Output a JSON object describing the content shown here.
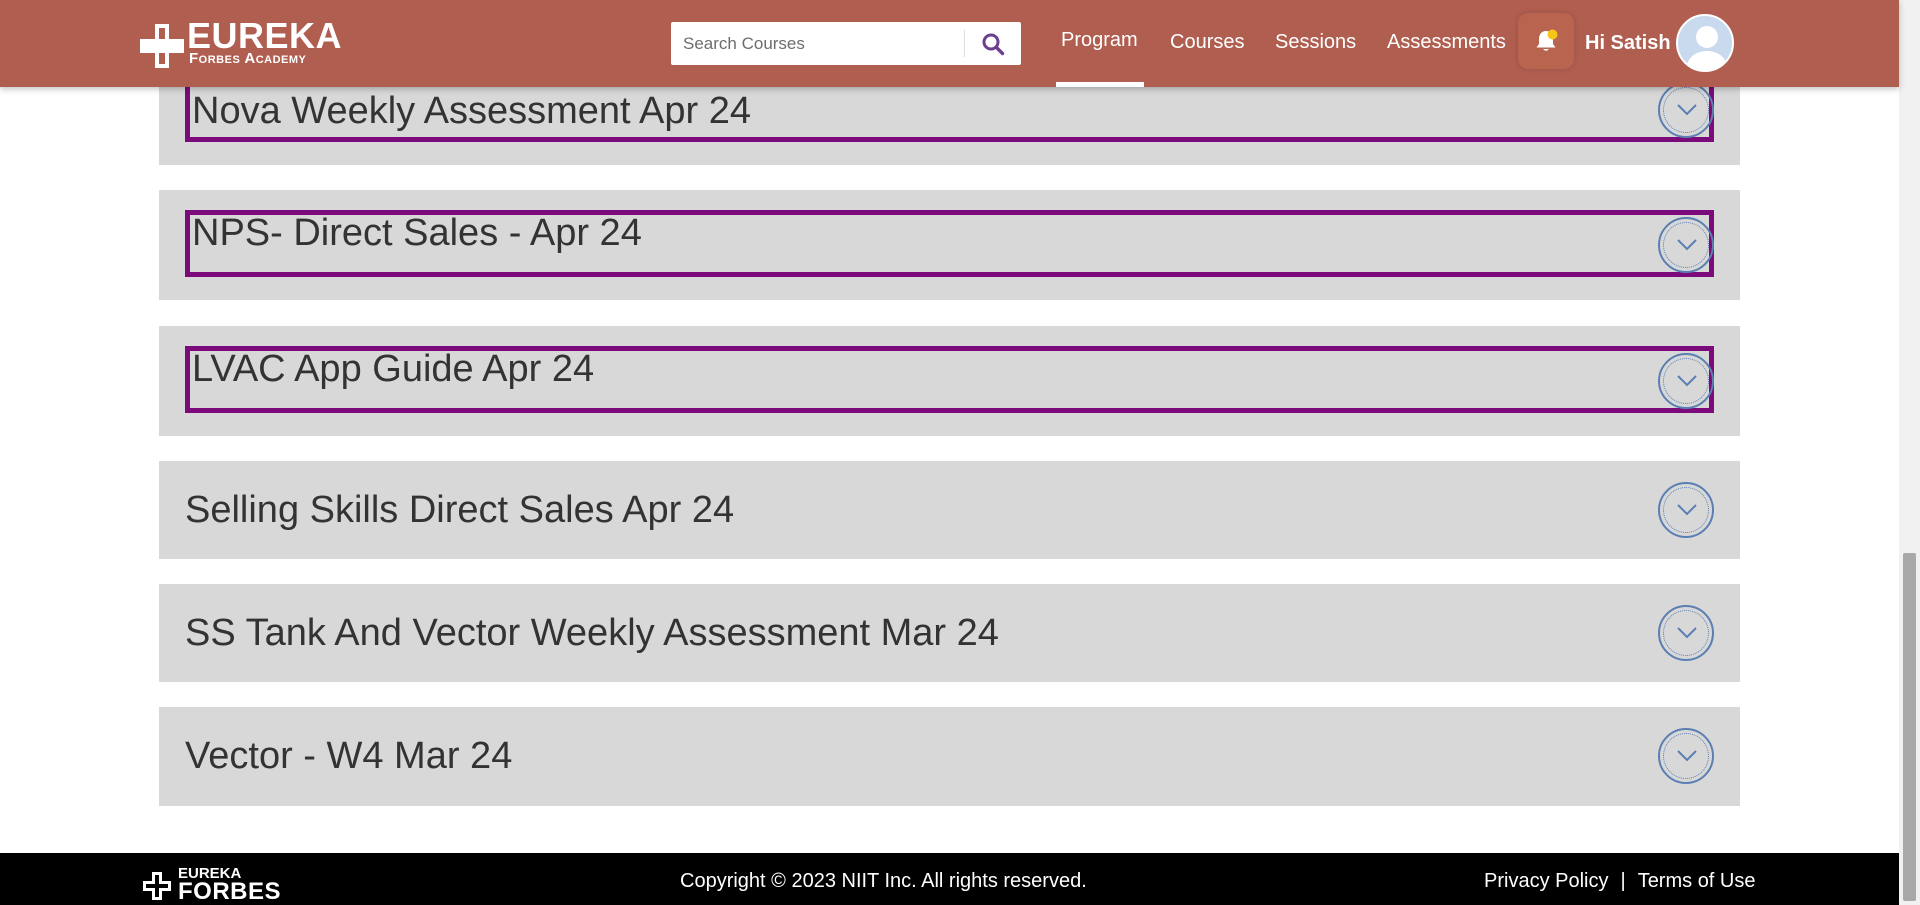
{
  "header": {
    "logo_line1": "EUREKA",
    "logo_line2": "Forbes Academy",
    "search": {
      "placeholder": "Search Courses",
      "value": ""
    },
    "nav": {
      "program": "Program",
      "courses": "Courses",
      "sessions": "Sessions",
      "assessments": "Assessments",
      "active": "Program"
    },
    "greeting": "Hi Satish",
    "colors": {
      "background": "#b05e50",
      "bell_dot": "#f5c518"
    }
  },
  "accordion": {
    "items": [
      {
        "title": "Nova Weekly Assessment Apr 24",
        "highlighted": true
      },
      {
        "title": "NPS- Direct Sales - Apr 24",
        "highlighted": true
      },
      {
        "title": "LVAC App Guide Apr 24",
        "highlighted": true
      },
      {
        "title": "Selling Skills Direct Sales Apr 24",
        "highlighted": false
      },
      {
        "title": "SS Tank And Vector Weekly Assessment Mar 24",
        "highlighted": false
      },
      {
        "title": "Vector - W4 Mar 24",
        "highlighted": false
      }
    ],
    "colors": {
      "panel": "#d8d8d8",
      "highlight_border": "#7b0a7b",
      "chevron": "#5b7fb2"
    }
  },
  "footer": {
    "logo_line1": "EUREKA",
    "logo_line2": "FORBES",
    "copyright": "Copyright © 2023 NIIT Inc. All rights reserved.",
    "privacy": "Privacy Policy",
    "separator": "|",
    "terms": "Terms of Use"
  }
}
